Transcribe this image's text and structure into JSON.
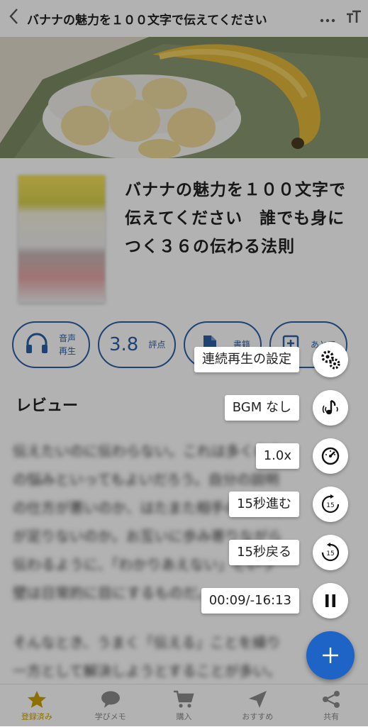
{
  "header": {
    "title": "バナナの魅力を１００文字で伝えてください",
    "back_icon": "chevron-left-icon",
    "more_icon": "more-horizontal-icon",
    "font_icon": "text-size-icon"
  },
  "book": {
    "title": "バナナの魅力を１００文字で伝えてください　誰でも身につく３６の伝わる法則"
  },
  "actions": {
    "audio_label_1": "音声",
    "audio_label_2": "再生",
    "rating_value": "3.8",
    "rating_label": "評点",
    "book_label": "書籍",
    "later_label": "あとで"
  },
  "review": {
    "heading": "レビュー",
    "lines": [
      "伝えたいのに伝わらない。これは多くの人",
      "の悩みといってもよいだろう。自分の説明",
      "の仕方が悪いのか、はたまた相手の理解力",
      "が足りないのか。お互いに歩み寄りながら",
      "伝わるように、「わかりあえない」という",
      "壁は日常的に目にするものだ。",
      "",
      "そんなとき、うまく「伝える」ことを繰り",
      "一方として解決しようとすることが多い。"
    ]
  },
  "player_menu": {
    "continuous": "連続再生の設定",
    "bgm": "BGM なし",
    "speed": "1.0x",
    "forward": "15秒進む",
    "backward": "15秒戻る",
    "time": "00:09/-16:13"
  },
  "bottom_nav": [
    {
      "label": "登録済み",
      "icon": "star-icon",
      "active": true
    },
    {
      "label": "学びメモ",
      "icon": "chat-bubble-icon",
      "active": false
    },
    {
      "label": "購入",
      "icon": "cart-icon",
      "active": false
    },
    {
      "label": "おすすめ",
      "icon": "send-icon",
      "active": false
    },
    {
      "label": "共有",
      "icon": "share-icon",
      "active": false
    }
  ],
  "colors": {
    "accent": "#2d5fa8",
    "fab": "#1e63c6",
    "nav_active": "#c9a100"
  }
}
